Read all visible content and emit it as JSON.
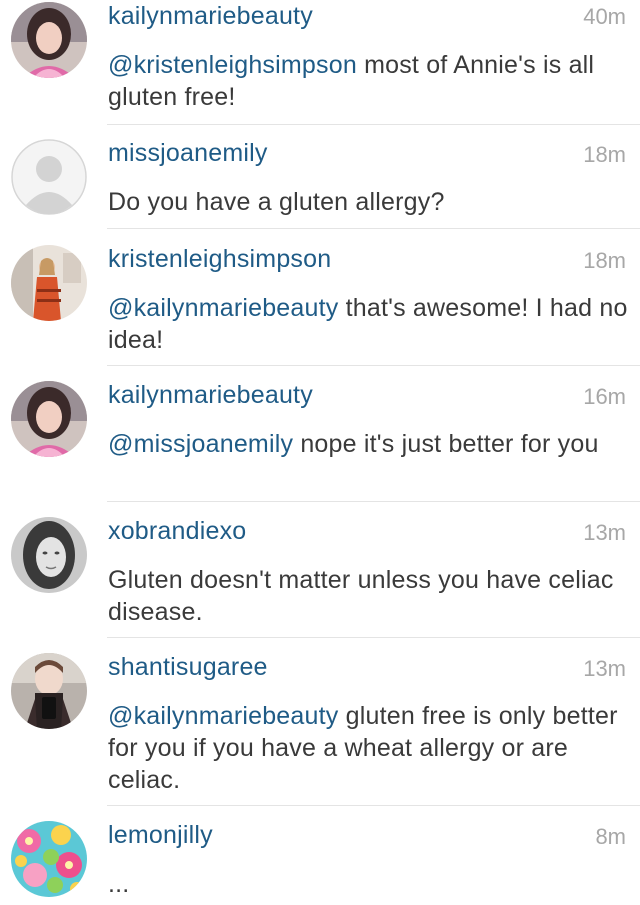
{
  "comments": [
    {
      "username": "kailynmariebeauty",
      "time": "40m",
      "mention": "@kristenleighsimpson",
      "text": " most of Annie's is all gluten free!",
      "avatar": "avatar-dark-hair-woman-icon"
    },
    {
      "username": "missjoanemily",
      "time": "18m",
      "mention": "",
      "text": "Do you have a gluten allergy?",
      "avatar": "default-profile-silhouette-icon"
    },
    {
      "username": "kristenleighsimpson",
      "time": "18m",
      "mention": "@kailynmariebeauty",
      "text": " that's awesome! I had no idea!",
      "avatar": "avatar-woman-orange-dress-icon"
    },
    {
      "username": "kailynmariebeauty",
      "time": "16m",
      "mention": "@missjoanemily",
      "text": " nope it's just better for you",
      "avatar": "avatar-dark-hair-woman-icon"
    },
    {
      "username": "xobrandiexo",
      "time": "13m",
      "mention": "",
      "text": "Gluten doesn't matter unless you have celiac disease.",
      "avatar": "avatar-bw-portrait-icon"
    },
    {
      "username": "shantisugaree",
      "time": "13m",
      "mention": "@kailynmariebeauty",
      "text": " gluten free is only better for you if you have a wheat allergy or are celiac.",
      "avatar": "avatar-woman-selfie-icon"
    },
    {
      "username": "lemonjilly",
      "time": "8m",
      "mention": "",
      "text": "...",
      "avatar": "avatar-floral-pattern-icon"
    }
  ],
  "colors": {
    "username": "#1f5b86",
    "mention": "#1f5b86",
    "text": "#3a3a3a",
    "time": "#a7a7a7",
    "divider": "#e4e4e4"
  }
}
